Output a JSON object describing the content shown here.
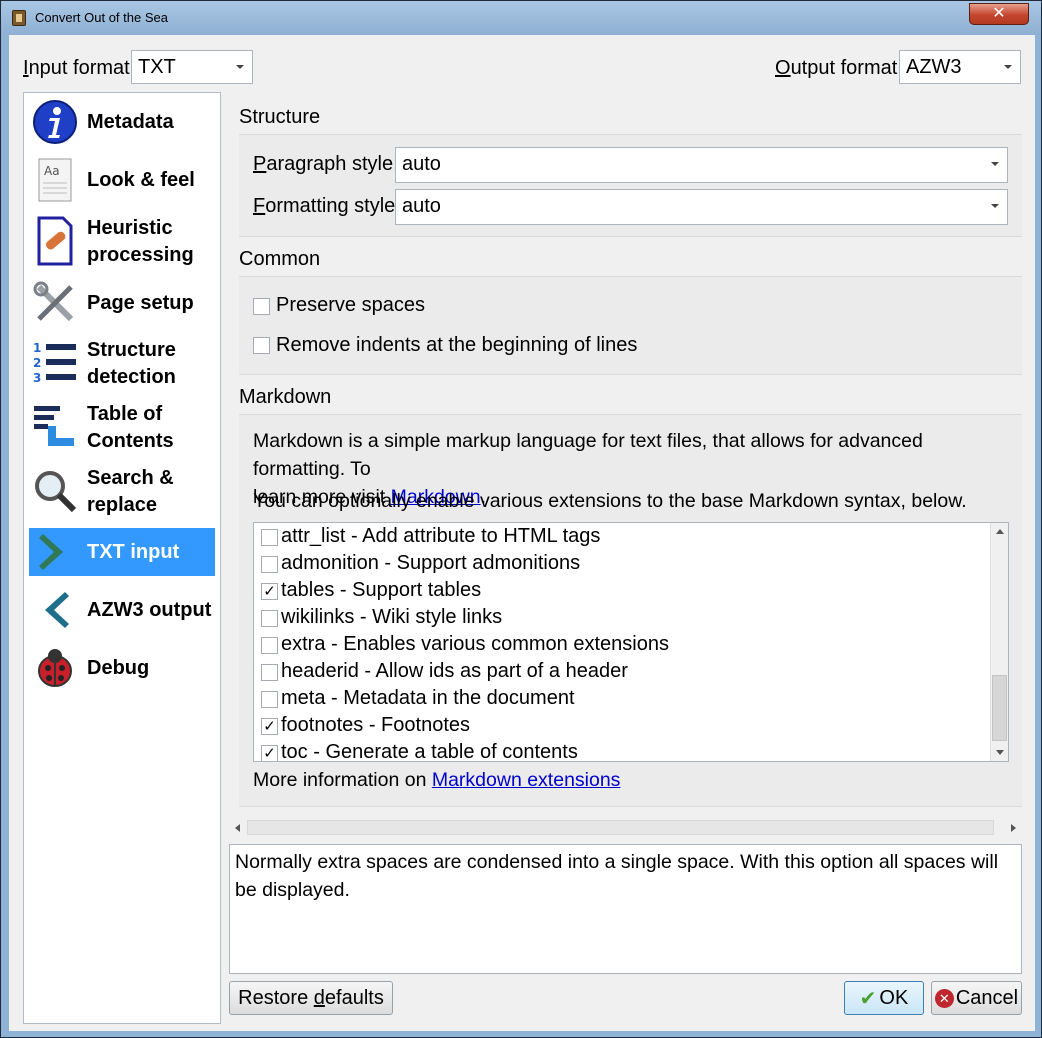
{
  "window": {
    "title": "Convert Out of the Sea",
    "close_glyph": "✕"
  },
  "formats": {
    "input_label": "Input format:",
    "input_value": "TXT",
    "output_label": "Output format:",
    "output_value": "AZW3"
  },
  "sidebar": {
    "items": [
      {
        "label_line1": "Metadata",
        "label_line2": "",
        "icon": "info-icon"
      },
      {
        "label_line1": "Look & feel",
        "label_line2": "",
        "icon": "look-feel-icon"
      },
      {
        "label_line1": "Heuristic",
        "label_line2": "processing",
        "icon": "heuristic-icon"
      },
      {
        "label_line1": "Page setup",
        "label_line2": "",
        "icon": "tools-icon"
      },
      {
        "label_line1": "Structure",
        "label_line2": "detection",
        "icon": "numbered-list-icon"
      },
      {
        "label_line1": "Table of",
        "label_line2": "Contents",
        "icon": "toc-icon"
      },
      {
        "label_line1": "Search &",
        "label_line2": "replace",
        "icon": "magnifier-icon"
      },
      {
        "label_line1": "TXT input",
        "label_line2": "",
        "icon": "chevron-right-icon",
        "active": true
      },
      {
        "label_line1": "AZW3 output",
        "label_line2": "",
        "icon": "chevron-left-icon"
      },
      {
        "label_line1": "Debug",
        "label_line2": "",
        "icon": "ladybug-icon"
      }
    ]
  },
  "structure": {
    "title": "Structure",
    "paragraph_label": "Paragraph style:",
    "paragraph_value": "auto",
    "formatting_label": "Formatting style:",
    "formatting_value": "auto"
  },
  "common": {
    "title": "Common",
    "preserve_spaces": "Preserve spaces",
    "remove_indents": "Remove indents at the beginning of lines"
  },
  "markdown": {
    "title": "Markdown",
    "desc_line1": "Markdown is a simple markup language for text files, that allows for advanced formatting. To",
    "desc_line2_prefix": "learn more visit ",
    "desc_link": "Markdown",
    "desc_line2_suffix": ".",
    "extensions_intro": "You can optionally enable various extensions to the base Markdown syntax, below.",
    "extensions": [
      {
        "label": "attr_list - Add attribute to HTML tags",
        "checked": false
      },
      {
        "label": "admonition - Support admonitions",
        "checked": false
      },
      {
        "label": "tables - Support tables",
        "checked": true
      },
      {
        "label": "wikilinks - Wiki style links",
        "checked": false
      },
      {
        "label": "extra - Enables various common extensions",
        "checked": false
      },
      {
        "label": "headerid - Allow ids as part of a header",
        "checked": false
      },
      {
        "label": "meta - Metadata in the document",
        "checked": false
      },
      {
        "label": "footnotes - Footnotes",
        "checked": true
      },
      {
        "label": "toc - Generate a table of contents",
        "checked": true
      }
    ],
    "more_info_prefix": "More information on ",
    "more_info_link": "Markdown extensions"
  },
  "help_text": "Normally extra spaces are condensed into a single space. With this option all spaces will be displayed.",
  "buttons": {
    "restore": "Restore defaults",
    "ok": "OK",
    "cancel": "Cancel"
  }
}
